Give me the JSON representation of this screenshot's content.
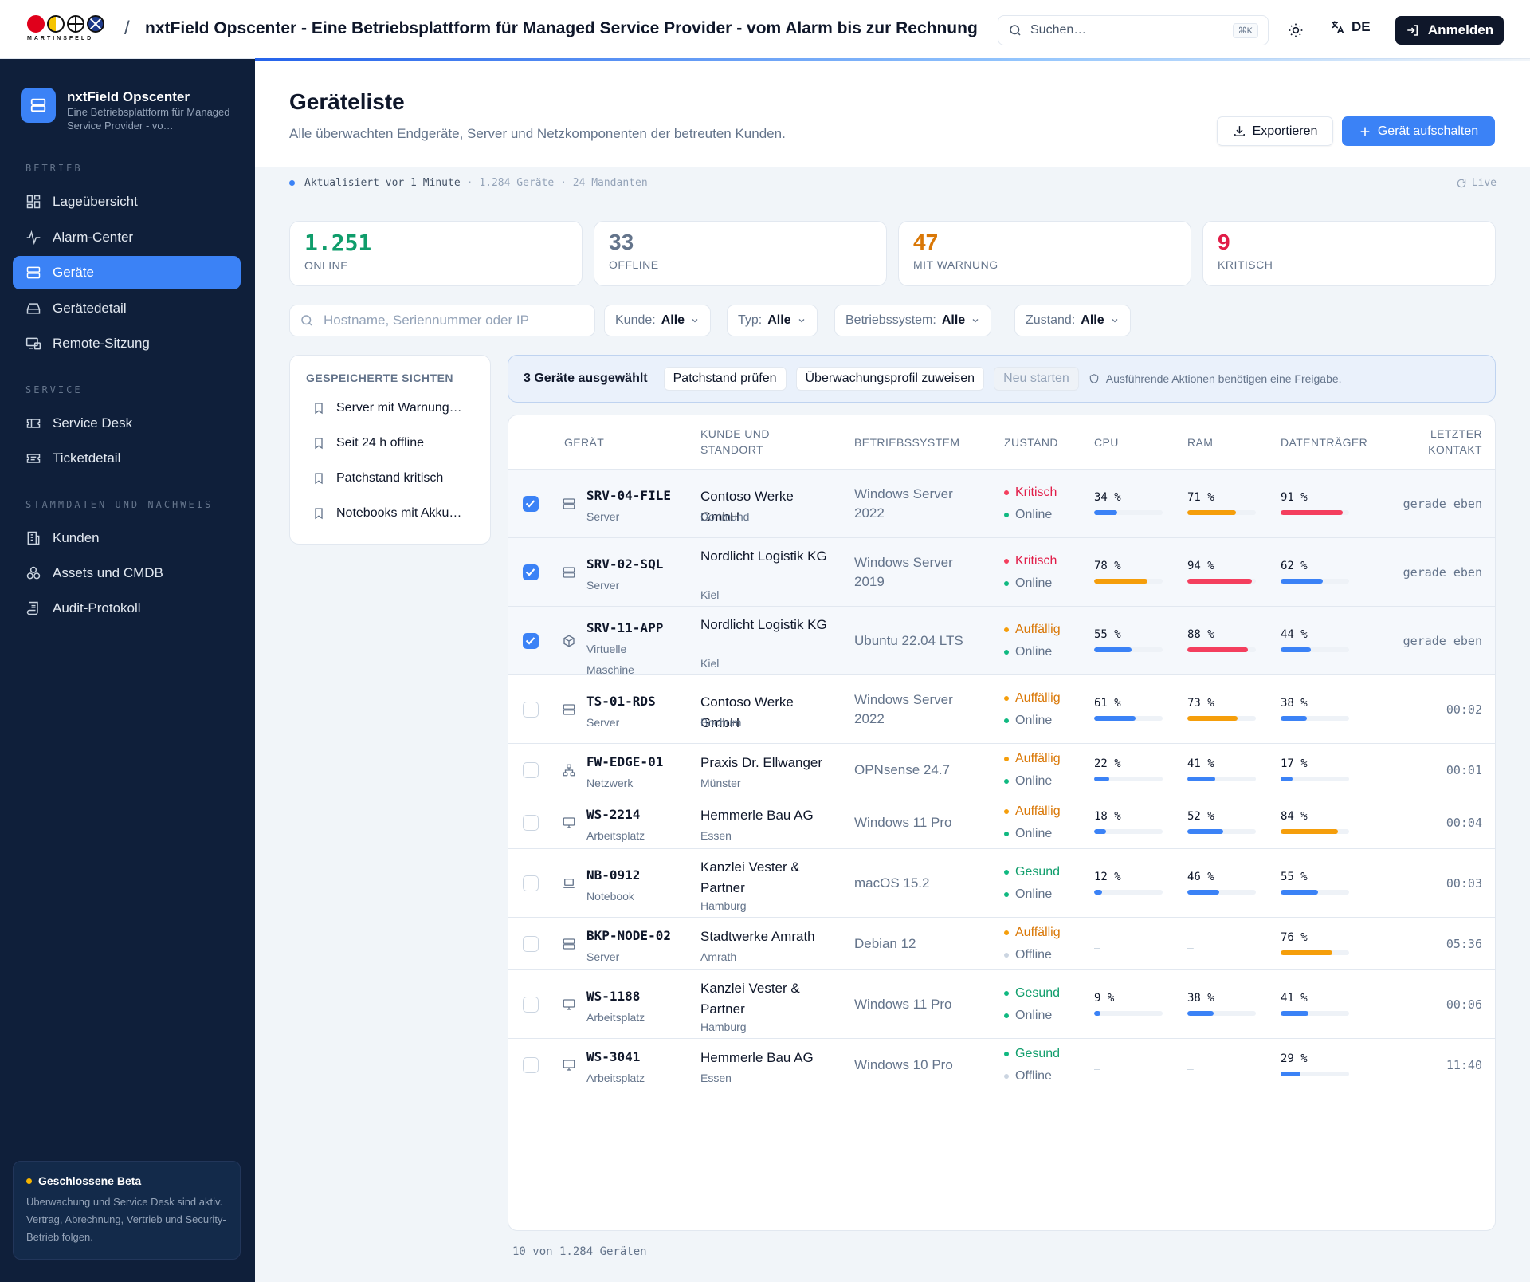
{
  "topbar": {
    "logo_text": "MARTINSFELD",
    "separator": "/",
    "title": "nxtField Opscenter - Eine Betriebsplattform für Managed Service Provider - vom Alarm bis zur Rechnung",
    "search_placeholder": "Suchen…",
    "search_shortcut": "⌘K",
    "lang": "DE",
    "login_label": "Anmelden"
  },
  "sidebar": {
    "brand_name": "nxtField Opscenter",
    "brand_sub": "Eine Betriebsplattform für Managed Service Provider - vo…",
    "sections": {
      "betrieb": "BETRIEB",
      "service": "SERVICE",
      "stammdaten": "STAMMDATEN UND NACHWEIS"
    },
    "items": [
      {
        "label": "Lageübersicht",
        "icon": "dashboard-icon"
      },
      {
        "label": "Alarm-Center",
        "icon": "pulse-icon"
      },
      {
        "label": "Geräte",
        "icon": "server-icon",
        "active": true
      },
      {
        "label": "Gerätedetail",
        "icon": "drive-icon"
      },
      {
        "label": "Remote-Sitzung",
        "icon": "remote-icon"
      },
      {
        "label": "Service Desk",
        "icon": "ticket-icon"
      },
      {
        "label": "Ticketdetail",
        "icon": "ticket-detail-icon"
      },
      {
        "label": "Kunden",
        "icon": "building-icon"
      },
      {
        "label": "Assets und CMDB",
        "icon": "boxes-icon"
      },
      {
        "label": "Audit-Protokoll",
        "icon": "scroll-icon"
      }
    ],
    "beta": {
      "title": "Geschlossene Beta",
      "text": "Überwachung und Service Desk sind aktiv. Vertrag, Abrechnung, Vertrieb und Security-Betrieb folgen."
    }
  },
  "header": {
    "title": "Geräteliste",
    "subtitle": "Alle überwachten Endgeräte, Server und Netzkomponenten der betreuten Kunden.",
    "export_label": "Exportieren",
    "add_label": "Gerät aufschalten"
  },
  "status": {
    "updated": "Aktualisiert vor 1 Minute",
    "meta": "· 1.284 Geräte · 24 Mandanten",
    "live": "Live"
  },
  "kpis": [
    {
      "value": "1.251",
      "label": "ONLINE",
      "color": "#0f9d6b"
    },
    {
      "value": "33",
      "label": "OFFLINE",
      "color": "#64748b"
    },
    {
      "value": "47",
      "label": "MIT WARNUNG",
      "color": "#d97706"
    },
    {
      "value": "9",
      "label": "KRITISCH",
      "color": "#e11d48"
    }
  ],
  "filters": {
    "search_placeholder": "Hostname, Seriennummer oder IP",
    "kunde_label": "Kunde:",
    "kunde_value": "Alle",
    "typ_label": "Typ:",
    "typ_value": "Alle",
    "os_label": "Betriebssystem:",
    "os_value": "Alle",
    "zustand_label": "Zustand:",
    "zustand_value": "Alle"
  },
  "saved_views": {
    "title": "GESPEICHERTE SICHTEN",
    "items": [
      "Server mit Warnung…",
      "Seit 24 h offline",
      "Patchstand kritisch",
      "Notebooks mit Akku…"
    ]
  },
  "selection": {
    "count_label": "3 Geräte ausgewählt",
    "action_patch": "Patchstand prüfen",
    "action_profile": "Überwachungsprofil zuweisen",
    "action_restart": "Neu starten",
    "hint": "Ausführende Aktionen benötigen eine Freigabe."
  },
  "table": {
    "headers": {
      "device": "GERÄT",
      "customer": "KUNDE UND STANDORT",
      "os": "BETRIEBSSYSTEM",
      "state": "ZUSTAND",
      "cpu": "CPU",
      "ram": "RAM",
      "disk": "DATENTRÄGER",
      "last": "LETZTER KONTAKT"
    },
    "rows": [
      {
        "selected": true,
        "icon": "server-icon",
        "host": "SRV-04-FILE",
        "type": "Server",
        "customer": "Contoso Werke GmbH",
        "location": "Dortmund",
        "os": "Windows Server 2022",
        "health": "Kritisch",
        "conn": "Online",
        "cpu": "34 %",
        "ram": "71 %",
        "disk": "91 %",
        "last": "gerade eben"
      },
      {
        "selected": true,
        "icon": "server-icon",
        "host": "SRV-02-SQL",
        "type": "Server",
        "customer": "Nordlicht Logistik KG",
        "location": "Kiel",
        "os": "Windows Server 2019",
        "health": "Kritisch",
        "conn": "Online",
        "cpu": "78 %",
        "ram": "94 %",
        "disk": "62 %",
        "last": "gerade eben"
      },
      {
        "selected": true,
        "icon": "cube-icon",
        "host": "SRV-11-APP",
        "type": "Virtuelle Maschine",
        "customer": "Nordlicht Logistik KG",
        "location": "Kiel",
        "os": "Ubuntu 22.04 LTS",
        "health": "Auffällig",
        "conn": "Online",
        "cpu": "55 %",
        "ram": "88 %",
        "disk": "44 %",
        "last": "gerade eben"
      },
      {
        "selected": false,
        "icon": "server-icon",
        "host": "TS-01-RDS",
        "type": "Server",
        "customer": "Contoso Werke GmbH",
        "location": "Bochum",
        "os": "Windows Server 2022",
        "health": "Auffällig",
        "conn": "Online",
        "cpu": "61 %",
        "ram": "73 %",
        "disk": "38 %",
        "last": "00:02"
      },
      {
        "selected": false,
        "icon": "network-icon",
        "host": "FW-EDGE-01",
        "type": "Netzwerk",
        "customer": "Praxis Dr. Ellwanger",
        "location": "Münster",
        "os": "OPNsense 24.7",
        "health": "Auffällig",
        "conn": "Online",
        "cpu": "22 %",
        "ram": "41 %",
        "disk": "17 %",
        "last": "00:01"
      },
      {
        "selected": false,
        "icon": "monitor-icon",
        "host": "WS-2214",
        "type": "Arbeitsplatz",
        "customer": "Hemmerle Bau AG",
        "location": "Essen",
        "os": "Windows 11 Pro",
        "health": "Auffällig",
        "conn": "Online",
        "cpu": "18 %",
        "ram": "52 %",
        "disk": "84 %",
        "last": "00:04"
      },
      {
        "selected": false,
        "icon": "laptop-icon",
        "host": "NB-0912",
        "type": "Notebook",
        "customer": "Kanzlei Vester & Partner",
        "location": "Hamburg",
        "os": "macOS 15.2",
        "health": "Gesund",
        "conn": "Online",
        "cpu": "12 %",
        "ram": "46 %",
        "disk": "55 %",
        "last": "00:03"
      },
      {
        "selected": false,
        "icon": "server-icon",
        "host": "BKP-NODE-02",
        "type": "Server",
        "customer": "Stadtwerke Amrath",
        "location": "Amrath",
        "os": "Debian 12",
        "health": "Auffällig",
        "conn": "Offline",
        "cpu": "–",
        "ram": "–",
        "disk": "76 %",
        "last": "05:36"
      },
      {
        "selected": false,
        "icon": "monitor-icon",
        "host": "WS-1188",
        "type": "Arbeitsplatz",
        "customer": "Kanzlei Vester & Partner",
        "location": "Hamburg",
        "os": "Windows 11 Pro",
        "health": "Gesund",
        "conn": "Online",
        "cpu": "9 %",
        "ram": "38 %",
        "disk": "41 %",
        "last": "00:06"
      },
      {
        "selected": false,
        "icon": "monitor-icon",
        "host": "WS-3041",
        "type": "Arbeitsplatz",
        "customer": "Hemmerle Bau AG",
        "location": "Essen",
        "os": "Windows 10 Pro",
        "health": "Gesund",
        "conn": "Offline",
        "cpu": "–",
        "ram": "–",
        "disk": "29 %",
        "last": "11:40"
      }
    ],
    "footer": "10 von 1.284 Geräten"
  },
  "colors": {
    "critical": "#f43f5e",
    "warning": "#f59e0b",
    "healthy": "#10b981",
    "online": "#10b981",
    "offline": "#cbd5e1",
    "bar_blue": "#3b82f6"
  }
}
